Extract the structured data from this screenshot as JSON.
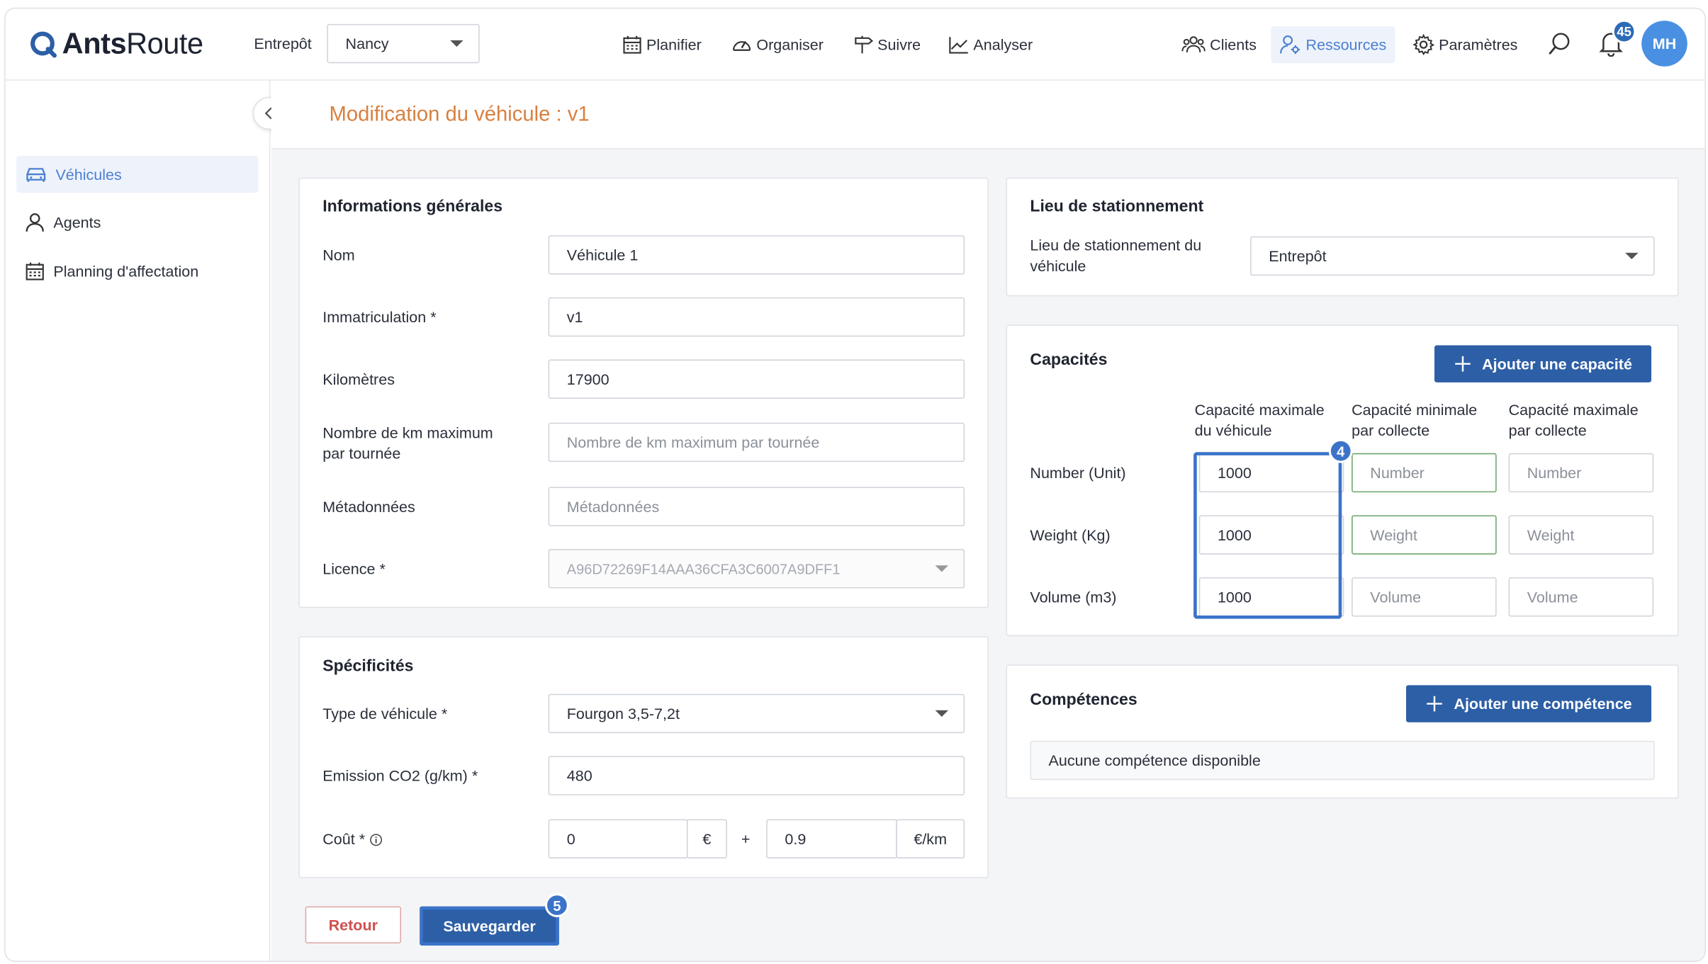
{
  "header": {
    "logo_ants": "Ants",
    "logo_route": "Route",
    "warehouse_label": "Entrepôt",
    "warehouse_value": "Nancy",
    "nav": {
      "planifier": "Planifier",
      "organiser": "Organiser",
      "suivre": "Suivre",
      "analyser": "Analyser",
      "clients": "Clients",
      "ressources": "Ressources",
      "parametres": "Paramètres"
    },
    "notification_count": "45",
    "avatar_initials": "MH"
  },
  "sidebar": {
    "items": [
      {
        "label": "Véhicules",
        "icon": "car-icon",
        "active": true
      },
      {
        "label": "Agents",
        "icon": "user-icon"
      },
      {
        "label": "Planning d'affectation",
        "icon": "calendar-icon"
      }
    ]
  },
  "page": {
    "title": "Modification du véhicule : v1"
  },
  "general": {
    "title": "Informations générales",
    "nom_label": "Nom",
    "nom_value": "Véhicule 1",
    "immat_label": "Immatriculation *",
    "immat_value": "v1",
    "km_label": "Kilomètres",
    "km_value": "17900",
    "kmmax_label_1": "Nombre de km maximum",
    "kmmax_label_2": "par tournée",
    "kmmax_placeholder": "Nombre de km maximum par tournée",
    "meta_label": "Métadonnées",
    "meta_placeholder": "Métadonnées",
    "licence_label": "Licence *",
    "licence_value": "A96D72269F14AAA36CFA3C6007A9DFF1"
  },
  "specs": {
    "title": "Spécificités",
    "type_label": "Type de véhicule *",
    "type_value": "Fourgon 3,5-7,2t",
    "co2_label": "Emission CO2 (g/km) *",
    "co2_value": "480",
    "cout_label": "Coût *",
    "cout_fixed": "0",
    "cout_fixed_unit": "€",
    "plus": "+",
    "cout_km": "0.9",
    "cout_km_unit": "€/km"
  },
  "parking": {
    "title": "Lieu de stationnement",
    "label_1": "Lieu de stationnement du",
    "label_2": "véhicule",
    "value": "Entrepôt"
  },
  "capacities": {
    "title": "Capacités",
    "add_button": "Ajouter une capacité",
    "col1_a": "Capacité maximale",
    "col1_b": "du véhicule",
    "col2_a": "Capacité minimale",
    "col2_b": "par collecte",
    "col3_a": "Capacité maximale",
    "col3_b": "par collecte",
    "rows": [
      {
        "label": "Number (Unit)",
        "max_vehicle": "1000",
        "min_placeholder": "Number",
        "max_placeholder": "Number"
      },
      {
        "label": "Weight (Kg)",
        "max_vehicle": "1000",
        "min_placeholder": "Weight",
        "max_placeholder": "Weight"
      },
      {
        "label": "Volume (m3)",
        "max_vehicle": "1000",
        "min_placeholder": "Volume",
        "max_placeholder": "Volume"
      }
    ],
    "step_badge": "4"
  },
  "skills": {
    "title": "Compétences",
    "add_button": "Ajouter une compétence",
    "empty": "Aucune compétence disponible"
  },
  "footer": {
    "back": "Retour",
    "save": "Sauvegarder",
    "step_badge": "5"
  }
}
